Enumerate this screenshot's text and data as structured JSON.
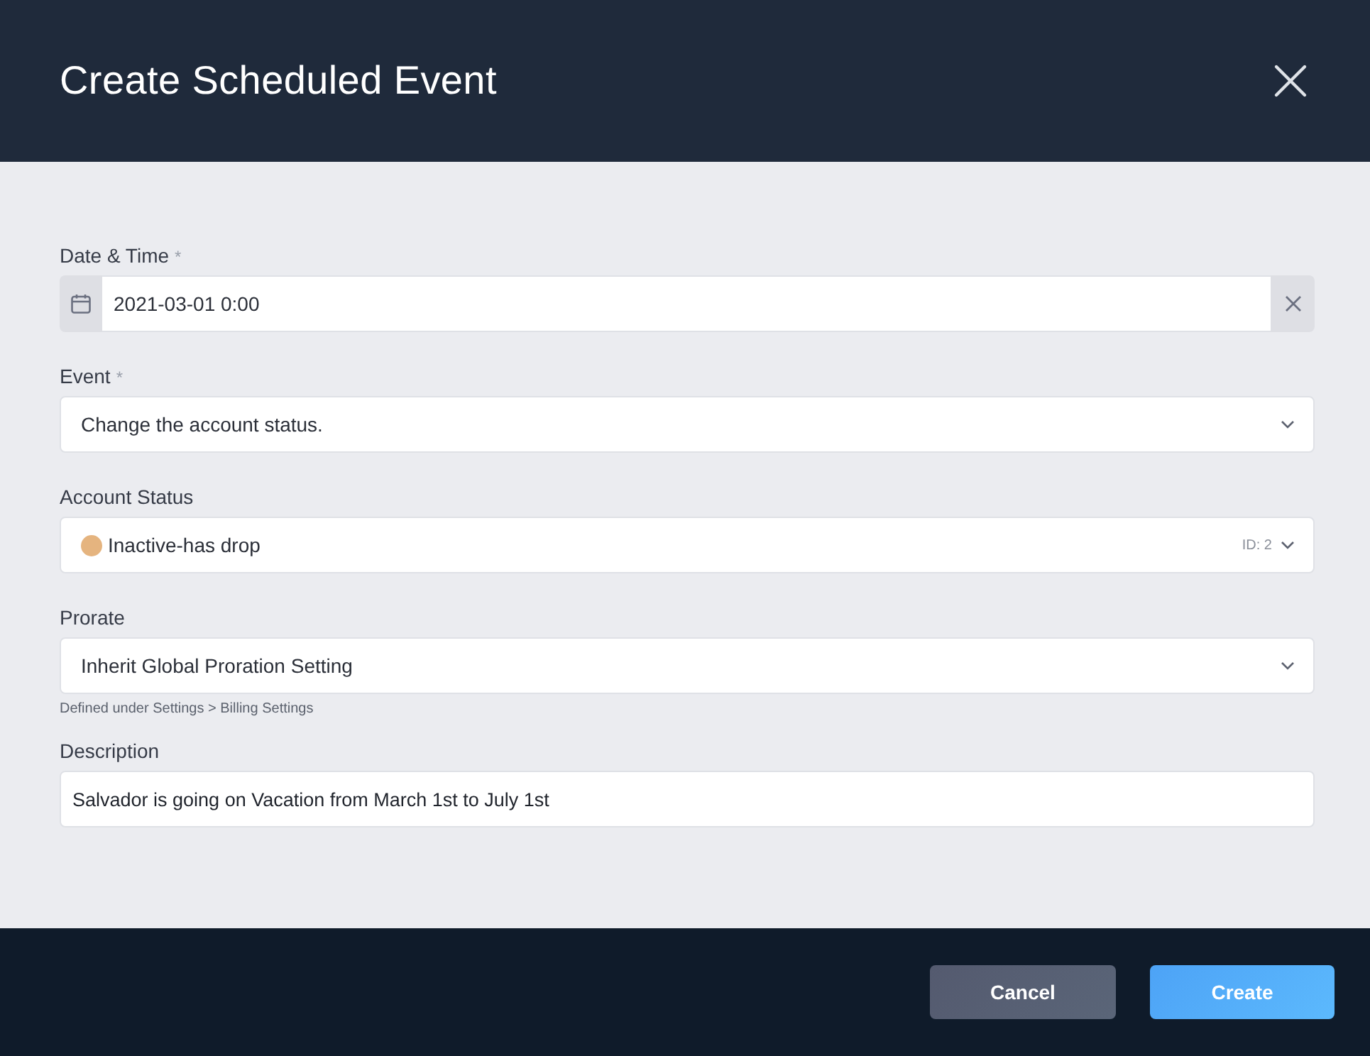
{
  "dialog": {
    "title": "Create Scheduled Event"
  },
  "fields": [
    {
      "kind": "date",
      "label": "Date & Time",
      "required_mark": "*",
      "value": "2021-03-01 0:00"
    },
    {
      "kind": "select",
      "label": "Event",
      "required_mark": "*",
      "value": "Change the account status."
    },
    {
      "kind": "status-select",
      "label": "Account Status",
      "value": "Inactive-has drop",
      "color": "#e5b47f",
      "id_tag": "ID: 2"
    },
    {
      "kind": "select",
      "label": "Prorate",
      "value": "Inherit Global Proration Setting",
      "hint": "Defined under Settings > Billing Settings"
    },
    {
      "kind": "text",
      "label": "Description",
      "value": "Salvador is going on Vacation from March 1st to July 1st"
    }
  ],
  "buttons": [
    {
      "kind": "secondary",
      "label": "Cancel"
    },
    {
      "kind": "primary",
      "label": "Create"
    }
  ]
}
